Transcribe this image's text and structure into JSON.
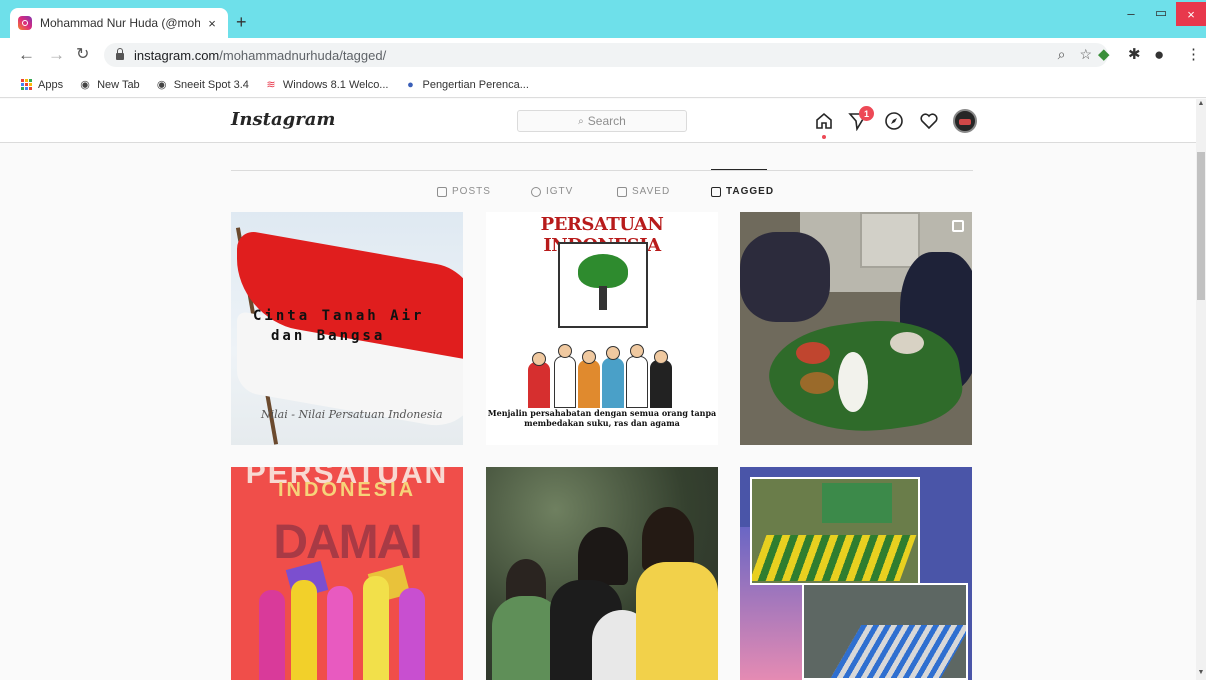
{
  "browser": {
    "tab_title": "Mohammad Nur Huda (@mohan",
    "tab_close": "×",
    "new_tab": "+",
    "url_host": "instagram.com",
    "url_path": "/mohammadnurhuda/tagged/",
    "window": {
      "minimize": "–",
      "maximize": "▭",
      "close": "×"
    },
    "bookmarks": [
      {
        "label": "Apps",
        "icon": "apps-grid-icon"
      },
      {
        "label": "New Tab",
        "icon": "globe-icon"
      },
      {
        "label": "Sneeit Spot 3.4",
        "icon": "globe-icon"
      },
      {
        "label": "Windows 8.1 Welco...",
        "icon": "wifi-icon"
      },
      {
        "label": "Pengertian Perenca...",
        "icon": "site-icon"
      }
    ]
  },
  "instagram": {
    "logo": "Instagram",
    "search_placeholder": "Search",
    "notification_count": "1",
    "tabs": [
      {
        "label": "POSTS",
        "active": false
      },
      {
        "label": "IGTV",
        "active": false
      },
      {
        "label": "SAVED",
        "active": false
      },
      {
        "label": "TAGGED",
        "active": true
      }
    ],
    "posts": {
      "p1": {
        "line1": "Cinta Tanah Air",
        "line2": "dan Bangsa",
        "signature": "Nilai - Nilai Persatuan Indonesia"
      },
      "p2": {
        "title": "PERSATUAN INDONESIA",
        "caption": "Menjalin persahabatan dengan semua orang tanpa membedakan suku, ras dan agama"
      },
      "p4": {
        "top": "PERSATUAN",
        "sub": "INDONESIA",
        "main": "DAMAI"
      }
    }
  },
  "colors": {
    "tabstrip": "#6ee0ea",
    "badge": "#ed4956",
    "close_button": "#e8384c"
  }
}
